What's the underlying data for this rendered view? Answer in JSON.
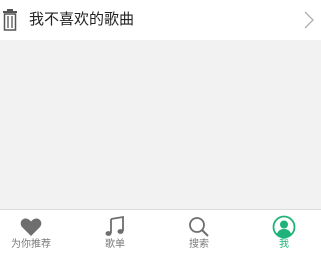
{
  "list": {
    "item_label": "我不喜欢的歌曲"
  },
  "tabbar": {
    "tabs": [
      {
        "label": "为你推荐",
        "icon": "heart-icon",
        "active": false
      },
      {
        "label": "歌单",
        "icon": "music-note-icon",
        "active": false
      },
      {
        "label": "搜索",
        "icon": "search-icon",
        "active": false
      },
      {
        "label": "我",
        "icon": "user-icon",
        "active": true
      }
    ]
  },
  "colors": {
    "accent": "#1fb37a",
    "inactive": "#7a7a7a",
    "background": "#f2f2f2"
  }
}
